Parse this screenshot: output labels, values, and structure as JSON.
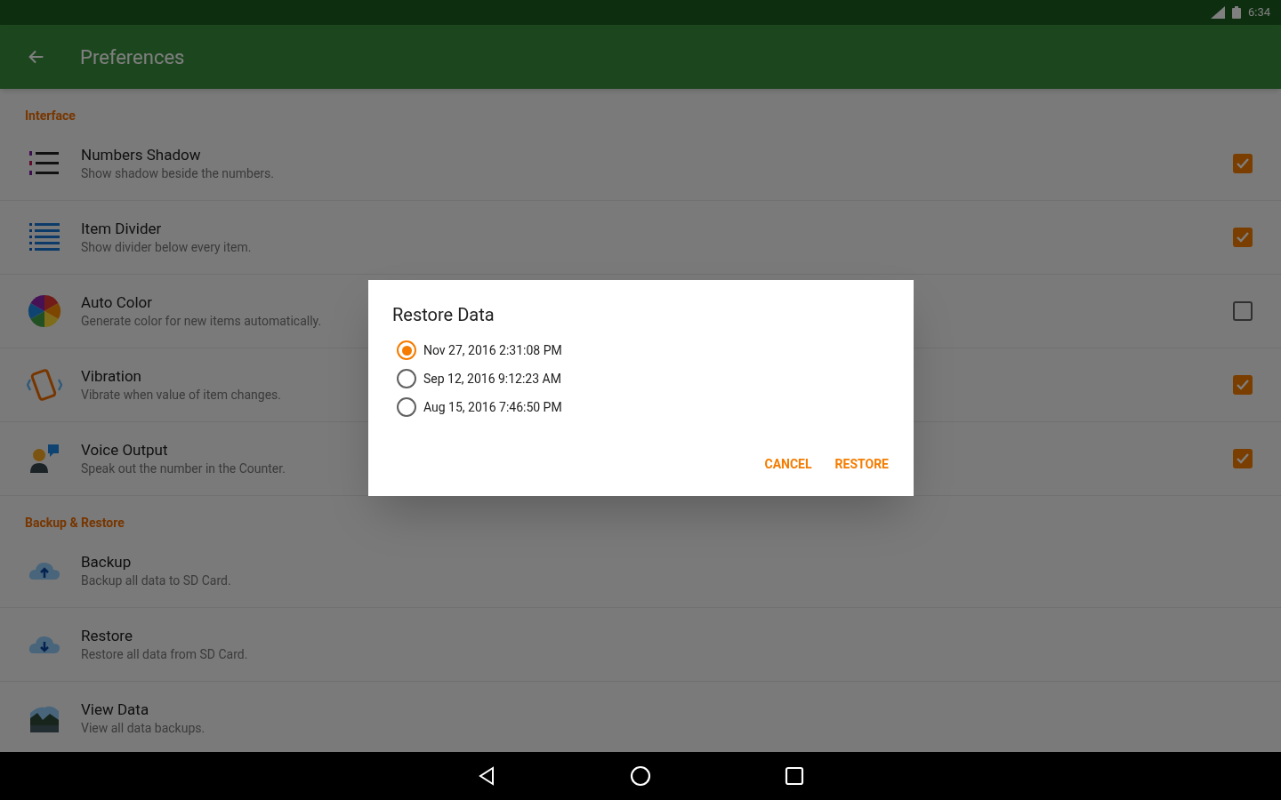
{
  "status_bar": {
    "time": "6:34"
  },
  "app_bar": {
    "title": "Preferences"
  },
  "sections": [
    {
      "header": "Interface",
      "items": [
        {
          "kind": "toggle",
          "title": "Numbers Shadow",
          "subtitle": "Show shadow beside the numbers.",
          "checked": true
        },
        {
          "kind": "toggle",
          "title": "Item Divider",
          "subtitle": "Show divider below every item.",
          "checked": true
        },
        {
          "kind": "toggle",
          "title": "Auto Color",
          "subtitle": "Generate color for new items automatically.",
          "checked": false
        },
        {
          "kind": "toggle",
          "title": "Vibration",
          "subtitle": "Vibrate when value of item changes.",
          "checked": true
        },
        {
          "kind": "toggle",
          "title": "Voice Output",
          "subtitle": "Speak out the number in the Counter.",
          "checked": true
        }
      ]
    },
    {
      "header": "Backup & Restore",
      "items": [
        {
          "kind": "action",
          "title": "Backup",
          "subtitle": "Backup all data to SD Card."
        },
        {
          "kind": "action",
          "title": "Restore",
          "subtitle": "Restore all data from SD Card."
        },
        {
          "kind": "action",
          "title": "View Data",
          "subtitle": "View all data backups."
        }
      ]
    }
  ],
  "dialog": {
    "title": "Restore Data",
    "options": [
      {
        "label": "Nov 27, 2016 2:31:08 PM",
        "selected": true
      },
      {
        "label": "Sep 12, 2016 9:12:23 AM",
        "selected": false
      },
      {
        "label": "Aug 15, 2016 7:46:50 PM",
        "selected": false
      }
    ],
    "buttons": [
      "CANCEL",
      "RESTORE"
    ]
  }
}
